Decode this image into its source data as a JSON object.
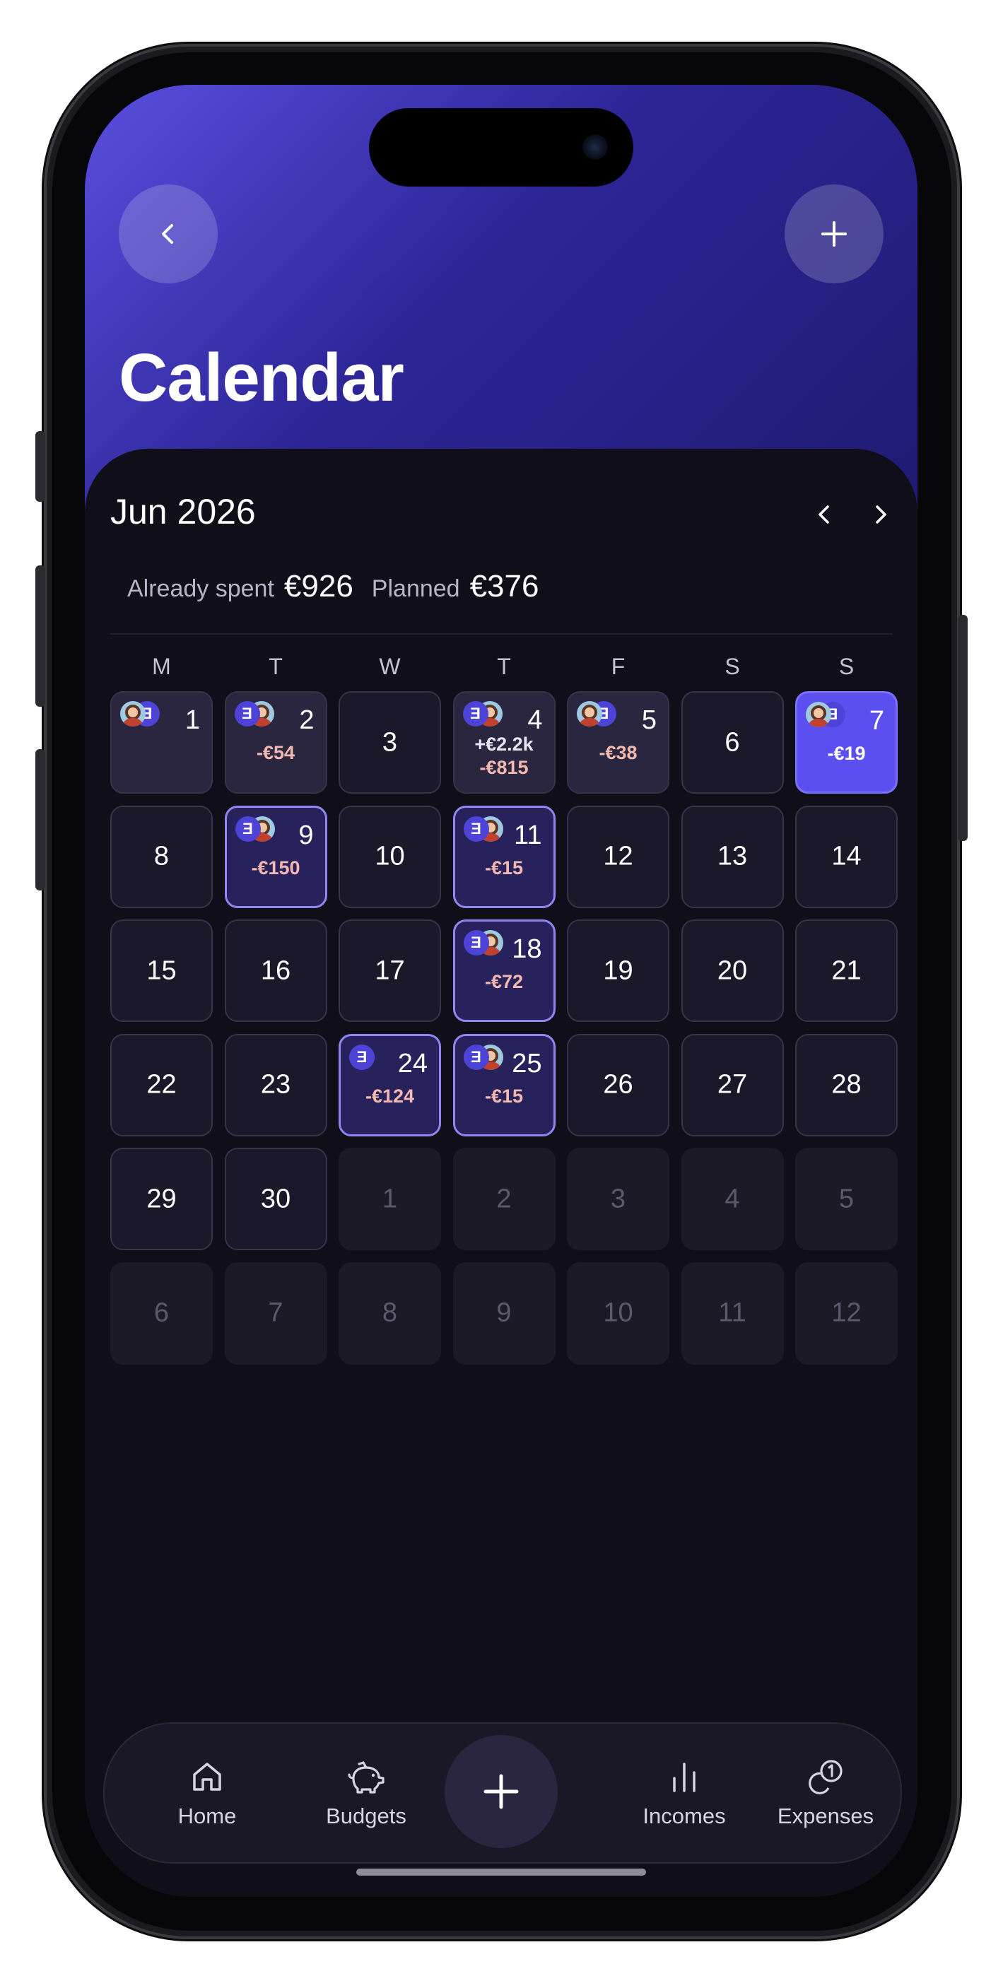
{
  "header": {
    "title": "Calendar"
  },
  "calendar": {
    "month": "Jun 2026",
    "summary": {
      "spent_label": "Already spent",
      "spent_value": "€926",
      "planned_label": "Planned",
      "planned_value": "€376"
    },
    "weekdays": [
      "M",
      "T",
      "W",
      "T",
      "F",
      "S",
      "S"
    ],
    "days": [
      {
        "day": "1",
        "state": "has",
        "avatars": [
          "person",
          "bank"
        ]
      },
      {
        "day": "2",
        "state": "has",
        "avatars": [
          "bank",
          "person"
        ],
        "amounts": [
          "-€54"
        ]
      },
      {
        "day": "3",
        "state": "normal"
      },
      {
        "day": "4",
        "state": "has",
        "avatars": [
          "bank",
          "person"
        ],
        "amounts": [
          "+€2.2k",
          "-€815"
        ]
      },
      {
        "day": "5",
        "state": "has",
        "avatars": [
          "person",
          "bank"
        ],
        "amounts": [
          "-€38"
        ]
      },
      {
        "day": "6",
        "state": "normal"
      },
      {
        "day": "7",
        "state": "today",
        "avatars": [
          "person",
          "bank"
        ],
        "amounts": [
          "-€19"
        ]
      },
      {
        "day": "8",
        "state": "normal"
      },
      {
        "day": "9",
        "state": "selected",
        "avatars": [
          "bank",
          "person"
        ],
        "amounts": [
          "-€150"
        ]
      },
      {
        "day": "10",
        "state": "normal"
      },
      {
        "day": "11",
        "state": "selected",
        "avatars": [
          "bank",
          "person"
        ],
        "amounts": [
          "-€15"
        ]
      },
      {
        "day": "12",
        "state": "normal"
      },
      {
        "day": "13",
        "state": "normal"
      },
      {
        "day": "14",
        "state": "normal"
      },
      {
        "day": "15",
        "state": "normal"
      },
      {
        "day": "16",
        "state": "normal"
      },
      {
        "day": "17",
        "state": "normal"
      },
      {
        "day": "18",
        "state": "selected",
        "avatars": [
          "bank",
          "person"
        ],
        "amounts": [
          "-€72"
        ]
      },
      {
        "day": "19",
        "state": "normal"
      },
      {
        "day": "20",
        "state": "normal"
      },
      {
        "day": "21",
        "state": "normal"
      },
      {
        "day": "22",
        "state": "normal"
      },
      {
        "day": "23",
        "state": "normal"
      },
      {
        "day": "24",
        "state": "selected",
        "avatars": [
          "bank"
        ],
        "amounts": [
          "-€124"
        ]
      },
      {
        "day": "25",
        "state": "selected",
        "avatars": [
          "bank",
          "person"
        ],
        "amounts": [
          "-€15"
        ]
      },
      {
        "day": "26",
        "state": "normal"
      },
      {
        "day": "27",
        "state": "normal"
      },
      {
        "day": "28",
        "state": "normal"
      },
      {
        "day": "29",
        "state": "normal"
      },
      {
        "day": "30",
        "state": "normal"
      },
      {
        "day": "1",
        "state": "other-month"
      },
      {
        "day": "2",
        "state": "other-month"
      },
      {
        "day": "3",
        "state": "other-month"
      },
      {
        "day": "4",
        "state": "other-month"
      },
      {
        "day": "5",
        "state": "other-month"
      },
      {
        "day": "6",
        "state": "other-month"
      },
      {
        "day": "7",
        "state": "other-month"
      },
      {
        "day": "8",
        "state": "other-month"
      },
      {
        "day": "9",
        "state": "other-month"
      },
      {
        "day": "10",
        "state": "other-month"
      },
      {
        "day": "11",
        "state": "other-month"
      },
      {
        "day": "12",
        "state": "other-month"
      }
    ],
    "bank_avatar_glyph": "Ǝ"
  },
  "tabbar": {
    "home": "Home",
    "budgets": "Budgets",
    "incomes": "Incomes",
    "expenses": "Expenses"
  },
  "icons": {
    "back": "chevron-left-icon",
    "add": "plus-icon",
    "prev_month": "chevron-left-icon",
    "next_month": "chevron-right-icon",
    "home": "house-icon",
    "budgets": "piggy-bank-icon",
    "incomes": "bar-chart-icon",
    "expenses": "coins-icon"
  },
  "colors": {
    "header_gradient_start": "#5a4fe0",
    "header_gradient_end": "#1f1b72",
    "background": "#100e18",
    "today": "#5b4ff0",
    "expense_amount": "#f3b9ae"
  }
}
